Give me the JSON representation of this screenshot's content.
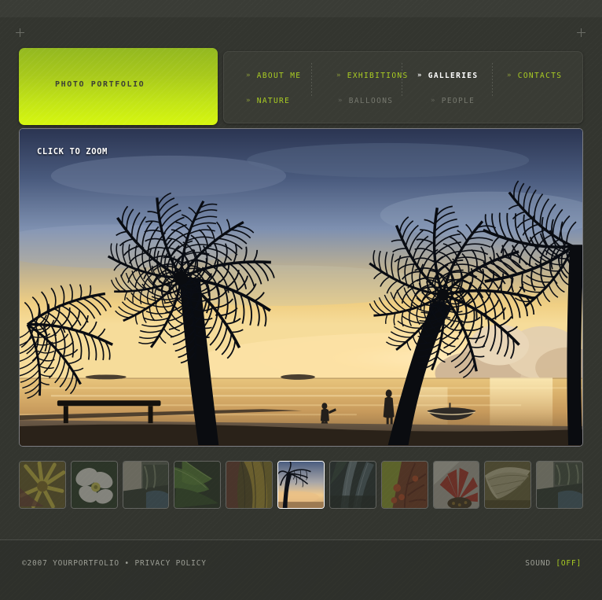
{
  "site": {
    "logo_text": "PHOTO PORTFOLIO",
    "accent_green": "#aacd23",
    "background": "#33352f"
  },
  "markers": {
    "top_left": "+",
    "top_right": "+"
  },
  "nav": {
    "chevron": "»",
    "main": [
      {
        "label": "ABOUT ME",
        "state": "green"
      },
      {
        "label": "EXHIBITIONS",
        "state": "green"
      },
      {
        "label": "GALLERIES",
        "state": "active"
      },
      {
        "label": "CONTACTS",
        "state": "green"
      }
    ],
    "sub": [
      {
        "label": "NATURE",
        "state": "green"
      },
      {
        "label": "BALLOONS",
        "state": "dim"
      },
      {
        "label": "PEOPLE",
        "state": "dim"
      }
    ]
  },
  "hero": {
    "caption": "CLICK TO ZOOM",
    "alt": "Palm tree silhouettes at sunset over a calm beach with figures and a boat"
  },
  "thumbnails": [
    {
      "name": "yellow-flower",
      "active": false
    },
    {
      "name": "white-flower",
      "active": false
    },
    {
      "name": "foliage-window",
      "active": false
    },
    {
      "name": "green-leaves",
      "active": false
    },
    {
      "name": "yellow-leaves",
      "active": false
    },
    {
      "name": "palm-sunset",
      "active": true
    },
    {
      "name": "blue-agave",
      "active": false
    },
    {
      "name": "red-branches",
      "active": false
    },
    {
      "name": "red-gerbera",
      "active": false
    },
    {
      "name": "dry-leaf",
      "active": false
    },
    {
      "name": "garden-path",
      "active": false
    }
  ],
  "footer": {
    "copyright": "©2007 YOURPORTFOLIO",
    "separator": "•",
    "privacy": "PRIVACY POLICY",
    "sound_label": "SOUND",
    "sound_state": "[OFF]"
  }
}
